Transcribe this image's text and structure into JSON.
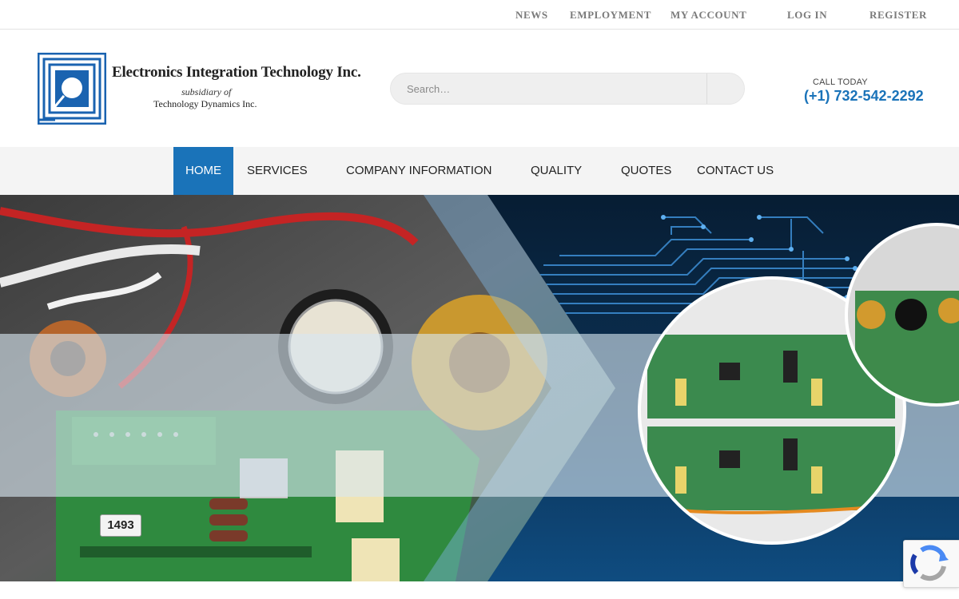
{
  "topbar": {
    "links": [
      "NEWS",
      "EMPLOYMENT",
      "MY ACCOUNT",
      "LOG IN",
      "REGISTER"
    ]
  },
  "logo": {
    "title": "Electronics Integration Technology Inc.",
    "subtitle": "subsidiary of",
    "parent": "Technology Dynamics Inc."
  },
  "search": {
    "placeholder": "Search…"
  },
  "contact": {
    "label": "CALL TODAY",
    "phone": "(+1) 732-542-2292"
  },
  "nav": {
    "items": [
      "HOME",
      "SERVICES",
      "COMPANY INFORMATION",
      "QUALITY",
      "QUOTES",
      "CONTACT US"
    ],
    "active": "HOME"
  },
  "hero": {
    "board_label": "1493"
  },
  "colors": {
    "accent": "#1a73b9",
    "nav_bg": "#f4f4f4",
    "hero_blue": "#0c3c6b"
  },
  "icons": {
    "search": "search-icon",
    "recaptcha": "recaptcha-icon"
  }
}
